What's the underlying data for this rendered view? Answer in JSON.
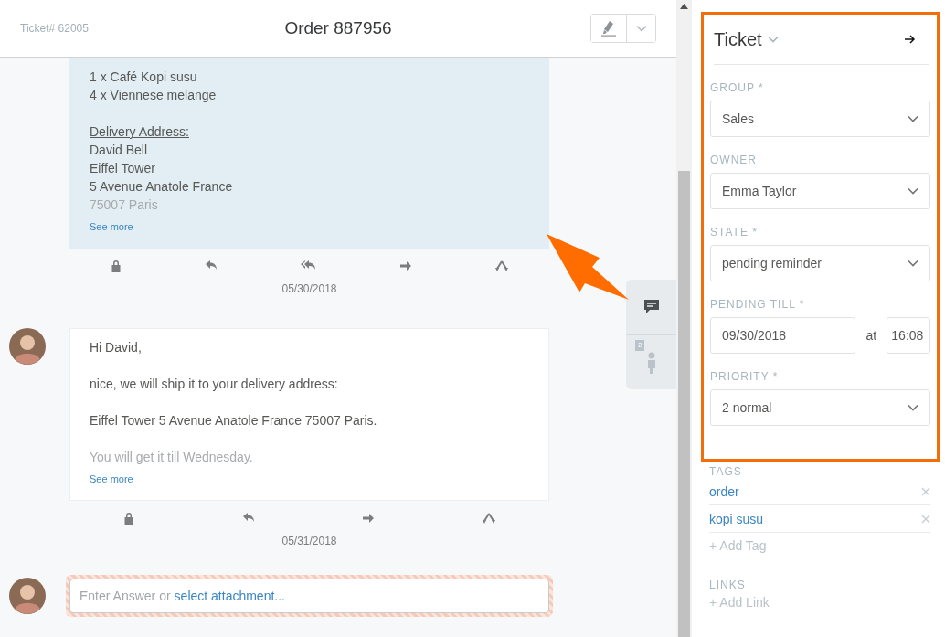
{
  "header": {
    "ticket_number": "Ticket# 62005",
    "title": "Order 887956"
  },
  "articles": [
    {
      "kind": "customer",
      "lines": [
        {
          "text": "1 x Café Kopi susu",
          "kind": "plain",
          "gap_before": false
        },
        {
          "text": "4 x Viennese melange",
          "kind": "plain",
          "gap_before": false
        },
        {
          "text": "Delivery Address:",
          "kind": "heading",
          "gap_before": true
        },
        {
          "text": "David Bell",
          "kind": "plain",
          "gap_before": false
        },
        {
          "text": "Eiffel Tower",
          "kind": "plain",
          "gap_before": false
        },
        {
          "text": "5 Avenue Anatole France",
          "kind": "plain",
          "gap_before": false
        },
        {
          "text": "75007 Paris",
          "kind": "faded",
          "gap_before": false
        }
      ],
      "see_more": "See more",
      "actions": [
        {
          "kind": "lock"
        },
        {
          "kind": "reply"
        },
        {
          "kind": "reply_all"
        },
        {
          "kind": "forward"
        },
        {
          "kind": "split"
        }
      ],
      "date": "05/30/2018"
    },
    {
      "kind": "agent",
      "lines": [
        {
          "text": "Hi David,",
          "kind": "plain",
          "gap_before": false
        },
        {
          "text": "nice, we will ship it to your delivery address:",
          "kind": "plain",
          "gap_before": true
        },
        {
          "text": "Eiffel Tower 5 Avenue Anatole France 75007 Paris.",
          "kind": "plain",
          "gap_before": true
        },
        {
          "text": "You will get it till Wednesday.",
          "kind": "faded",
          "gap_before": true
        }
      ],
      "see_more": "See more",
      "actions": [
        {
          "kind": "lock"
        },
        {
          "kind": "reply"
        },
        {
          "kind": "forward"
        },
        {
          "kind": "split"
        }
      ],
      "date": "05/31/2018"
    }
  ],
  "reply": {
    "placeholder": "Enter Answer or",
    "attachment_link": "select attachment..."
  },
  "side_tabs": [
    {
      "kind": "chat",
      "selected": true
    },
    {
      "kind": "customer",
      "selected": false,
      "badge": "2"
    }
  ],
  "sidebar": {
    "title": "Ticket",
    "highlighted": true,
    "fields": [
      {
        "kind": "select",
        "label": "GROUP *",
        "value": "Sales"
      },
      {
        "kind": "select",
        "label": "OWNER",
        "value": "Emma Taylor"
      },
      {
        "kind": "select",
        "label": "STATE *",
        "value": "pending reminder"
      },
      {
        "kind": "datetime",
        "label": "PENDING TILL *",
        "date": "09/30/2018",
        "at": "at",
        "time": "16:08"
      },
      {
        "kind": "select",
        "label": "PRIORITY *",
        "value": "2 normal"
      }
    ],
    "tags": {
      "label": "TAGS",
      "items": [
        "order",
        "kopi susu"
      ],
      "add": "+ Add Tag"
    },
    "links": {
      "label": "LINKS",
      "add": "+ Add Link"
    }
  }
}
